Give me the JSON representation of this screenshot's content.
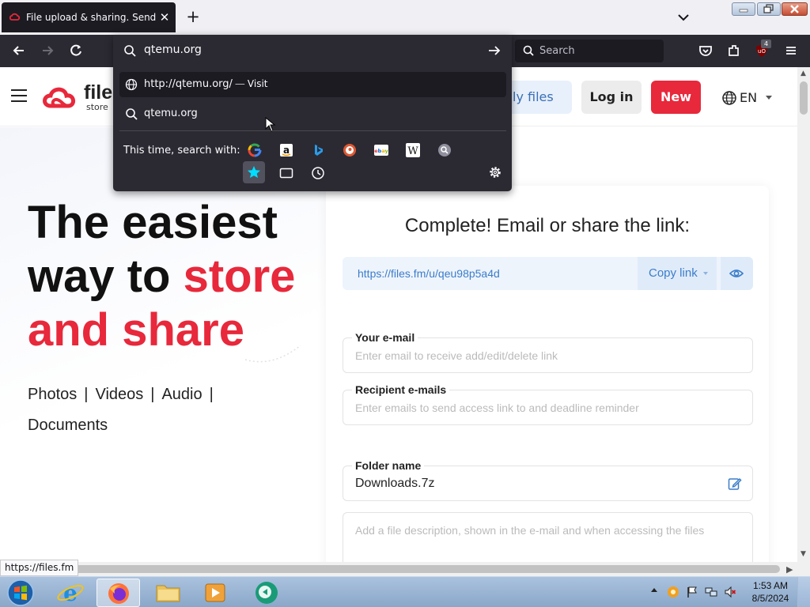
{
  "browser": {
    "tab_title": "File upload & sharing. Send lar",
    "tab_close": "✕",
    "newtab": "+",
    "search_placeholder": "Search",
    "extension_badge": "4"
  },
  "urlbar": {
    "value": "qtemu.org",
    "suggestions": {
      "visit_url": "http://qtemu.org/",
      "visit_sep": "—",
      "visit_label": "Visit",
      "search_term": "qtemu.org"
    },
    "search_with_label": "This time, search with:",
    "engines": [
      "google-icon",
      "amazon-icon",
      "bing-icon",
      "duckduckgo-icon",
      "ebay-icon",
      "wikipedia-icon",
      "search-engine-icon"
    ],
    "modes": [
      "bookmarks-icon",
      "tabs-icon",
      "history-icon"
    ]
  },
  "site": {
    "logo_word": "file",
    "logo_sub": "store",
    "myfiles_label": "ly files",
    "login_label": "Log in",
    "new_label": "New",
    "lang_label": "EN",
    "brand_color": "#e8283b"
  },
  "hero": {
    "line1": "The easiest",
    "line2_a": "way to ",
    "line2_b": "store",
    "line3": "and share",
    "links": [
      "Photos",
      "|",
      "Videos",
      "|",
      "Audio",
      "|",
      "Documents"
    ]
  },
  "card": {
    "title": "Complete! Email or share the link:",
    "share_url": "https://files.fm/u/qeu98p5a4d",
    "copy_label": "Copy link",
    "email_label": "Your e-mail",
    "email_placeholder": "Enter email to receive add/edit/delete link",
    "recipients_label": "Recipient e-mails",
    "recipients_placeholder": "Enter emails to send access link to and deadline reminder",
    "folder_label": "Folder name",
    "folder_value": "Downloads.7z",
    "description_placeholder": "Add a file description, shown in the e-mail and when accessing the files"
  },
  "status_link": "https://files.fm",
  "taskbar": {
    "time": "1:53 AM",
    "date": "8/5/2024"
  }
}
